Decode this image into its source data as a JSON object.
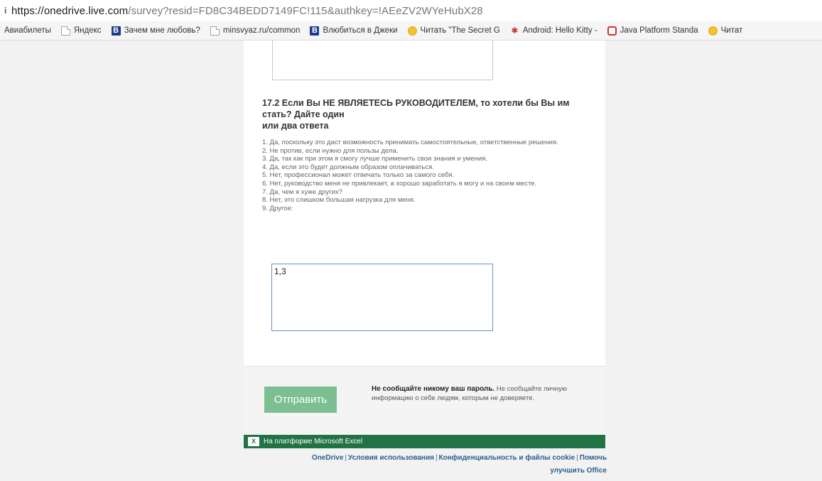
{
  "address_bar": {
    "host": "https://onedrive.live.com",
    "path": "/survey?resid=FD8C34BEDD7149FC!115&authkey=!AEeZV2WYeHubX28"
  },
  "bookmarks": [
    {
      "label": "Авиабилеты",
      "icon": "none"
    },
    {
      "label": "Яндекс",
      "icon": "page-icon"
    },
    {
      "label": "Зачем мне любовь?",
      "icon": "b-icon"
    },
    {
      "label": "minsvyaz.ru/common",
      "icon": "page-icon"
    },
    {
      "label": "Влюбиться в Джеки",
      "icon": "b-icon"
    },
    {
      "label": "Читать \"The Secret G",
      "icon": "reader-icon"
    },
    {
      "label": "Android: Hello Kitty -",
      "icon": "paw-icon"
    },
    {
      "label": "Java Platform Standa",
      "icon": "java-icon"
    },
    {
      "label": "Читат",
      "icon": "reader-icon"
    }
  ],
  "question": {
    "title": "17.2 Если Вы НЕ ЯВЛЯЕТЕСЬ РУКОВОДИТЕЛЕМ, то хотели бы Вы им стать? Дайте один",
    "title_line2": "или два ответа",
    "options": [
      "1. Да, поскольку это даст возможность принимать самостоятельные, ответственные решения.",
      "2. Не против, если нужно для пользы дела.",
      "3. Да, так как при этом я смогу лучше применить свои знания и умения.",
      "4. Да, если это будет должным образом оплачиваться.",
      "5. Нет, профессионал может отвечать только за самого себя.",
      "6. Нет, руководство меня не привлекает, а хорошо заработать я могу и на своем месте.",
      "7. Да, чем я хуже других?",
      "8. Нет, это слишком большая нагрузка для меня.",
      "9. Другое:"
    ],
    "answer_value": "1,3"
  },
  "submit": {
    "label": "Отправить",
    "notice_bold": "Не сообщайте никому ваш пароль.",
    "notice_text": " Не сообщайте личную информацию о себе людям, которым не доверяете."
  },
  "excel_bar": {
    "label": "На платформе Microsoft Excel"
  },
  "footer_links": {
    "onedrive": "OneDrive",
    "terms": "Условия использования",
    "privacy": "Конфиденциальность и файлы cookie",
    "help1": "Помочь",
    "help2": "улучшить Office"
  },
  "colors": {
    "submit_bg": "#7dbf91",
    "excel_green": "#217346",
    "link": "#2c5e8e"
  }
}
